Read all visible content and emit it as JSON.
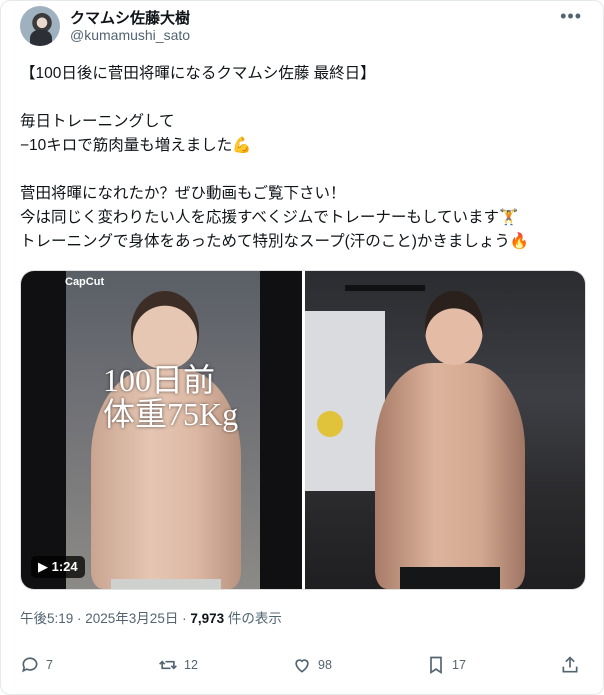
{
  "author": {
    "name": "クマムシ佐藤大樹",
    "handle": "@kumamushi_sato"
  },
  "post": {
    "text": "【100日後に菅田将暉になるクマムシ佐藤 最終日】\n\n毎日トレーニングして\n−10キロで筋肉量も増えました💪\n\n菅田将暉になれたか？ぜひ動画もご覧下さい！\n今は同じく変わりたい人を応援すべくジムでトレーナーもしています🏋\nトレーニングで身体をあっためて特別なスープ(汗のこと)かきましょう🔥"
  },
  "media": {
    "watermark": "CapCut",
    "overlay_line1": "100日前",
    "overlay_line2": "体重75Kg",
    "duration": "1:24"
  },
  "meta": {
    "time": "午後5:19 · 2025年3月25日 · ",
    "views": "7,973",
    "views_suffix": " 件の表示"
  },
  "actions": {
    "replies": "7",
    "reposts": "12",
    "likes": "98",
    "bookmarks": "17"
  },
  "icons": [
    "more-icon",
    "reply-icon",
    "repost-icon",
    "like-icon",
    "bookmark-icon",
    "share-icon",
    "play-icon"
  ]
}
